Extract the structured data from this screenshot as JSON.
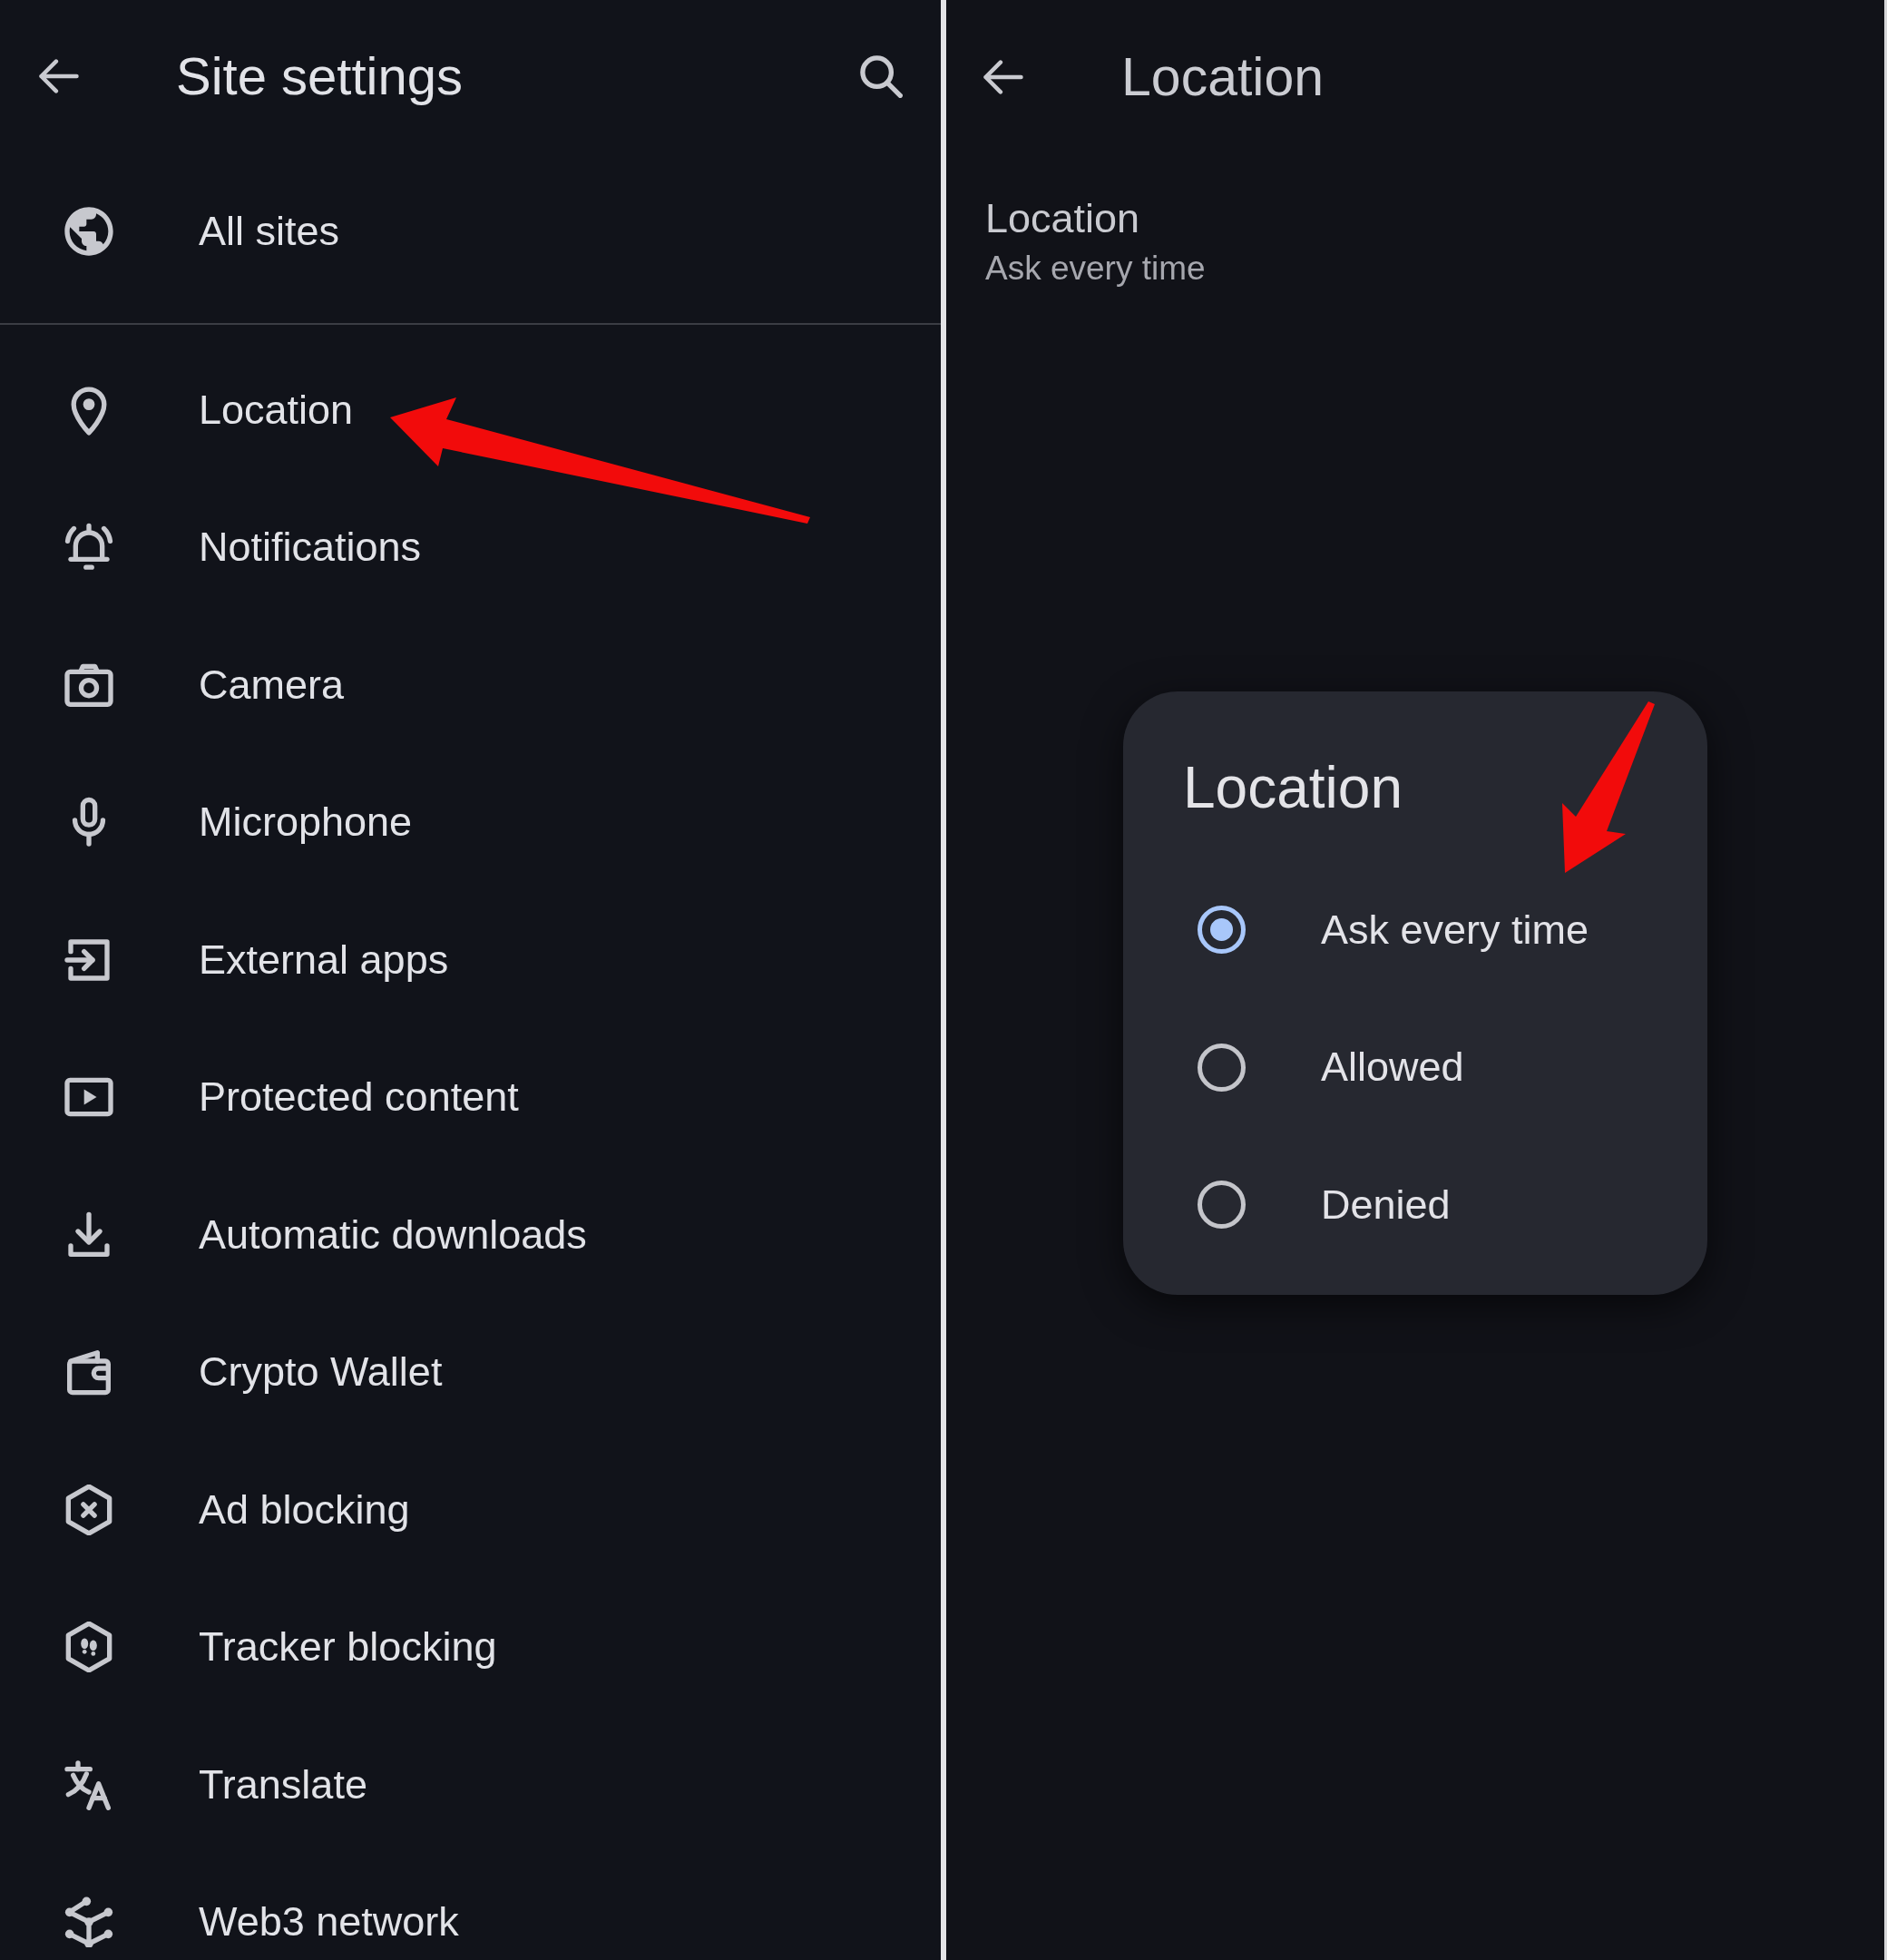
{
  "site_settings": {
    "title": "Site settings",
    "sections": [
      {
        "items": [
          {
            "label": "All sites",
            "arrow": false
          }
        ]
      },
      {
        "items": [
          {
            "label": "Location",
            "arrow": true
          },
          {
            "label": "Notifications",
            "arrow": false
          },
          {
            "label": "Camera",
            "arrow": false
          },
          {
            "label": "Microphone",
            "arrow": false
          },
          {
            "label": "External apps",
            "arrow": false
          },
          {
            "label": "Protected content",
            "arrow": false
          },
          {
            "label": "Automatic downloads",
            "arrow": false
          },
          {
            "label": "Crypto Wallet",
            "arrow": false
          },
          {
            "label": "Ad blocking",
            "arrow": false
          },
          {
            "label": "Tracker blocking",
            "arrow": false
          },
          {
            "label": "Translate",
            "arrow": false
          },
          {
            "label": "Web3 network",
            "arrow": false
          }
        ]
      }
    ]
  },
  "location_page": {
    "title": "Location",
    "setting": {
      "label": "Location",
      "value": "Ask every time"
    },
    "dialog": {
      "title": "Location",
      "options": [
        {
          "label": "Ask every time",
          "selected": true,
          "arrow": true
        },
        {
          "label": "Allowed",
          "selected": false,
          "arrow": false
        },
        {
          "label": "Denied",
          "selected": false,
          "arrow": false
        }
      ]
    }
  }
}
